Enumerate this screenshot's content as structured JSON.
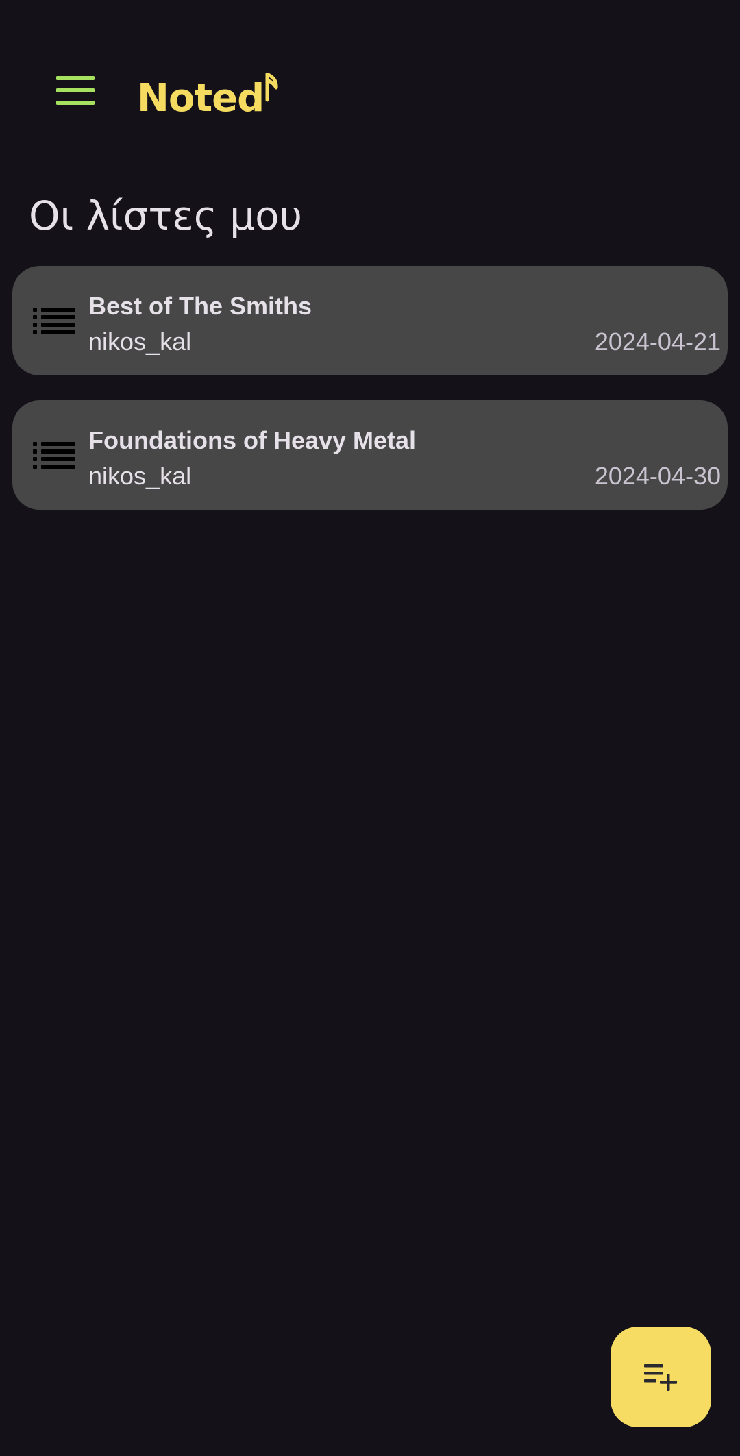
{
  "theme": {
    "background": "#141218",
    "accent_menu": "#a6e15f",
    "accent_logo": "#f5dc61",
    "card_background": "#474747",
    "fab_background": "#f7dc64",
    "fab_icon": "#2b2930",
    "list_icon": "#000000"
  },
  "app_bar": {
    "menu_icon": "hamburger-menu-icon",
    "logo_text": "Noted",
    "logo_glyph": "music-note-icon"
  },
  "page": {
    "title": "Οι λίστες μου"
  },
  "lists": [
    {
      "icon": "list-icon",
      "name": "Best of The Smiths",
      "owner": "nikos_kal",
      "date": "2024-04-21"
    },
    {
      "icon": "list-icon",
      "name": "Foundations of Heavy Metal",
      "owner": "nikos_kal",
      "date": "2024-04-30"
    }
  ],
  "fab": {
    "icon": "playlist-add-icon"
  }
}
